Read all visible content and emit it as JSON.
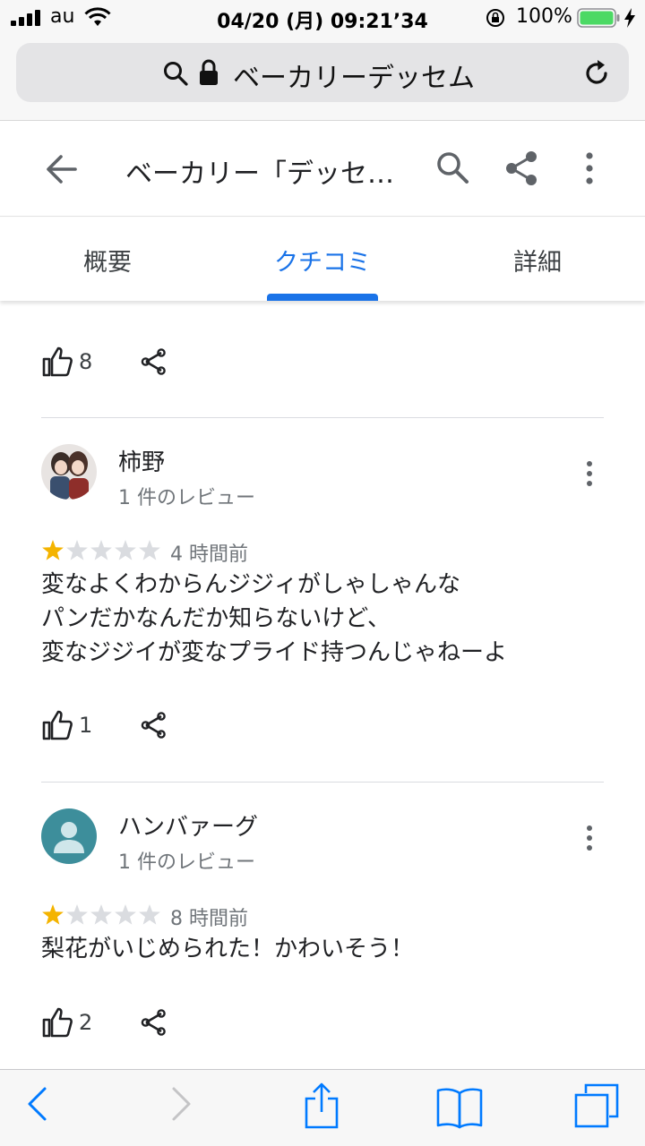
{
  "status_bar": {
    "carrier": "au",
    "datetime": "04/20 (月) 09:21’34",
    "battery_percent": "100%",
    "battery_level": 1.0
  },
  "browser": {
    "url_text": "ベーカリーデッセム"
  },
  "app_header": {
    "title": "ベーカリー「デッセ…"
  },
  "tabs": [
    {
      "label": "概要",
      "active": false
    },
    {
      "label": "クチコミ",
      "active": true
    },
    {
      "label": "詳細",
      "active": false
    }
  ],
  "previous_review_actions": {
    "like_count": "8"
  },
  "reviews": [
    {
      "name": "柿野",
      "review_count": "1 件のレビュー",
      "rating": 1,
      "time": "4 時間前",
      "text_lines": [
        "変なよくわからんジジィがしゃしゃんな",
        "パンだかなんだか知らないけど、",
        "変なジジイが変なプライド持つんじゃねーよ"
      ],
      "like_count": "1",
      "avatar": "photo"
    },
    {
      "name": "ハンバァーグ",
      "review_count": "1 件のレビュー",
      "rating": 1,
      "time": "8 時間前",
      "text_lines": [
        "梨花がいじめられた！かわいそう！"
      ],
      "like_count": "2",
      "avatar": "default-person"
    }
  ],
  "colors": {
    "accent": "#1a73e8",
    "star_filled": "#f4b400",
    "star_empty": "#dadce0",
    "ios_blue": "#007aff",
    "battery_green": "#4cd964"
  },
  "icons": {
    "back": "arrow-left-icon",
    "search": "search-icon",
    "share": "share-icon",
    "more": "more-vert-icon",
    "like": "thumb-up-icon"
  }
}
